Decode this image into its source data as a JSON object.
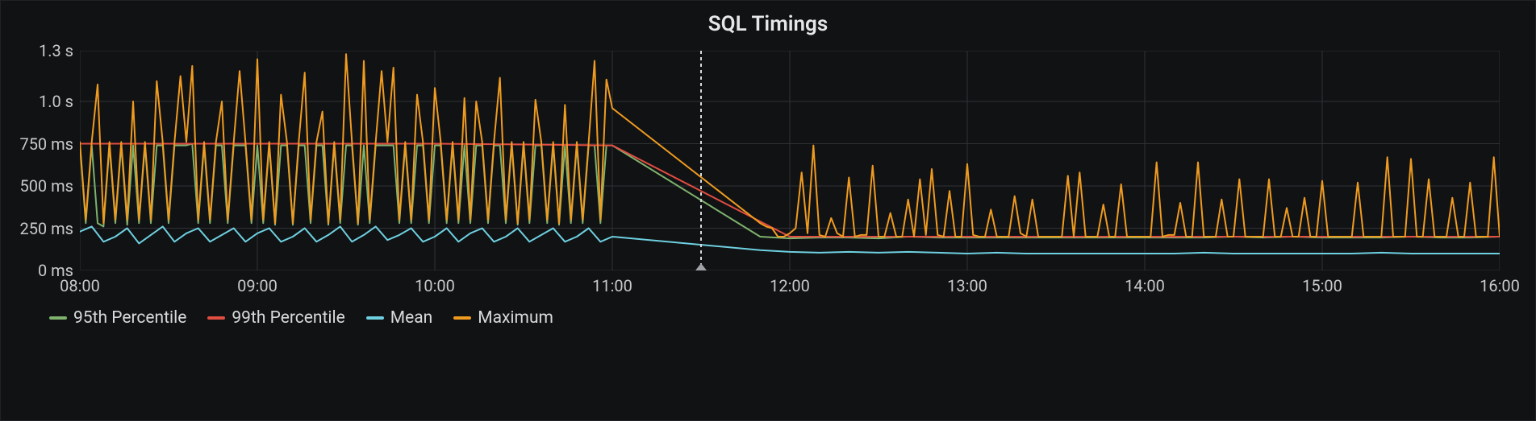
{
  "title": "SQL Timings",
  "legend": [
    {
      "key": "p95",
      "label": "95th Percentile",
      "color": "#7eb26d"
    },
    {
      "key": "p99",
      "label": "99th Percentile",
      "color": "#e24d42"
    },
    {
      "key": "mean",
      "label": "Mean",
      "color": "#6ed0e0"
    },
    {
      "key": "max",
      "label": "Maximum",
      "color": "#ef9b20"
    }
  ],
  "axes": {
    "y": {
      "min": 0,
      "max": 1300,
      "ticks": [
        {
          "v": 0,
          "label": "0 ms"
        },
        {
          "v": 250,
          "label": "250 ms"
        },
        {
          "v": 500,
          "label": "500 ms"
        },
        {
          "v": 750,
          "label": "750 ms"
        },
        {
          "v": 1000,
          "label": "1.0 s"
        },
        {
          "v": 1300,
          "label": "1.3 s"
        }
      ]
    },
    "x": {
      "min": 0,
      "max": 480,
      "ticks": [
        {
          "v": 0,
          "label": "08:00"
        },
        {
          "v": 60,
          "label": "09:00"
        },
        {
          "v": 120,
          "label": "10:00"
        },
        {
          "v": 180,
          "label": "11:00"
        },
        {
          "v": 240,
          "label": "12:00"
        },
        {
          "v": 300,
          "label": "13:00"
        },
        {
          "v": 360,
          "label": "14:00"
        },
        {
          "v": 420,
          "label": "15:00"
        },
        {
          "v": 480,
          "label": "16:00"
        }
      ]
    }
  },
  "cursor_x": 210,
  "chart_data": {
    "type": "line",
    "xlabel": "",
    "ylabel": "",
    "xlim": [
      "08:00",
      "16:00"
    ],
    "ylim": [
      0,
      1300
    ],
    "x_minutes_from_0800": true,
    "cursor_at": "11:30",
    "series": [
      {
        "name": "Maximum",
        "color": "#ef9b20",
        "x": [
          0,
          2,
          4,
          6,
          8,
          10,
          12,
          14,
          16,
          18,
          20,
          22,
          24,
          26,
          28,
          30,
          32,
          34,
          36,
          38,
          40,
          42,
          44,
          46,
          48,
          50,
          52,
          54,
          56,
          58,
          60,
          62,
          64,
          66,
          68,
          70,
          72,
          74,
          76,
          78,
          80,
          82,
          84,
          86,
          88,
          90,
          92,
          94,
          96,
          98,
          100,
          102,
          104,
          106,
          108,
          110,
          112,
          114,
          116,
          118,
          120,
          122,
          124,
          126,
          128,
          130,
          132,
          134,
          136,
          138,
          140,
          142,
          144,
          146,
          148,
          150,
          152,
          154,
          156,
          158,
          160,
          162,
          164,
          166,
          168,
          170,
          172,
          174,
          176,
          178,
          180,
          230,
          232,
          234,
          236,
          238,
          240,
          242,
          244,
          246,
          248,
          250,
          252,
          254,
          256,
          258,
          260,
          262,
          264,
          266,
          268,
          270,
          272,
          274,
          276,
          278,
          280,
          282,
          284,
          286,
          288,
          290,
          292,
          294,
          296,
          298,
          300,
          302,
          304,
          306,
          308,
          310,
          312,
          314,
          316,
          318,
          320,
          322,
          324,
          326,
          328,
          330,
          332,
          334,
          336,
          338,
          340,
          342,
          344,
          346,
          348,
          350,
          352,
          354,
          356,
          358,
          360,
          362,
          364,
          366,
          368,
          370,
          372,
          374,
          376,
          378,
          380,
          382,
          384,
          386,
          388,
          390,
          392,
          394,
          396,
          398,
          400,
          402,
          404,
          406,
          408,
          410,
          412,
          414,
          416,
          418,
          420,
          422,
          424,
          426,
          428,
          430,
          432,
          434,
          436,
          438,
          440,
          442,
          444,
          446,
          448,
          450,
          452,
          454,
          456,
          458,
          460,
          462,
          464,
          466,
          468,
          470,
          472,
          474,
          476,
          478,
          480
        ],
        "y": [
          760,
          300,
          760,
          1100,
          280,
          760,
          300,
          760,
          300,
          1000,
          300,
          760,
          300,
          1120,
          760,
          300,
          760,
          1150,
          760,
          1210,
          300,
          760,
          300,
          760,
          1000,
          300,
          760,
          1180,
          760,
          300,
          1250,
          300,
          760,
          280,
          1040,
          760,
          280,
          760,
          1170,
          300,
          760,
          940,
          280,
          760,
          300,
          1280,
          760,
          280,
          1240,
          300,
          760,
          1180,
          760,
          1200,
          300,
          760,
          300,
          1040,
          760,
          300,
          1080,
          760,
          300,
          760,
          300,
          1020,
          300,
          1000,
          760,
          300,
          760,
          1140,
          300,
          760,
          280,
          760,
          300,
          1010,
          760,
          300,
          760,
          280,
          980,
          300,
          760,
          300,
          760,
          1240,
          300,
          1130,
          960,
          280,
          260,
          250,
          200,
          200,
          220,
          250,
          580,
          220,
          740,
          210,
          200,
          310,
          220,
          200,
          550,
          200,
          210,
          210,
          620,
          200,
          200,
          340,
          200,
          200,
          420,
          200,
          540,
          210,
          600,
          210,
          200,
          470,
          200,
          200,
          630,
          210,
          200,
          200,
          360,
          200,
          200,
          200,
          440,
          220,
          200,
          420,
          200,
          200,
          200,
          200,
          200,
          560,
          200,
          580,
          200,
          200,
          200,
          390,
          200,
          200,
          510,
          200,
          200,
          200,
          200,
          200,
          640,
          200,
          210,
          210,
          400,
          200,
          200,
          640,
          200,
          200,
          200,
          420,
          200,
          200,
          540,
          200,
          200,
          200,
          200,
          540,
          200,
          200,
          370,
          200,
          200,
          430,
          200,
          200,
          530,
          200,
          200,
          200,
          200,
          200,
          520,
          200,
          200,
          200,
          200,
          670,
          200,
          200,
          200,
          660,
          200,
          200,
          540,
          200,
          200,
          200,
          430,
          200,
          200,
          520,
          200,
          200,
          200,
          670,
          200,
          250
        ]
      },
      {
        "name": "95th Percentile",
        "color": "#7eb26d",
        "x": [
          0,
          2,
          4,
          6,
          8,
          10,
          12,
          14,
          16,
          18,
          20,
          22,
          24,
          26,
          28,
          30,
          32,
          34,
          36,
          38,
          40,
          42,
          44,
          46,
          48,
          50,
          52,
          54,
          56,
          58,
          60,
          62,
          64,
          66,
          68,
          70,
          72,
          74,
          76,
          78,
          80,
          82,
          84,
          86,
          88,
          90,
          92,
          94,
          96,
          98,
          100,
          102,
          104,
          106,
          108,
          110,
          112,
          114,
          116,
          118,
          120,
          122,
          124,
          126,
          128,
          130,
          132,
          134,
          136,
          138,
          140,
          142,
          144,
          146,
          148,
          150,
          152,
          154,
          156,
          158,
          160,
          162,
          164,
          166,
          168,
          170,
          172,
          174,
          176,
          178,
          180,
          230,
          240,
          250,
          260,
          270,
          280,
          290,
          300,
          310,
          320,
          330,
          340,
          350,
          360,
          370,
          380,
          390,
          400,
          410,
          420,
          430,
          440,
          450,
          460,
          470,
          480
        ],
        "y": [
          740,
          280,
          740,
          280,
          260,
          740,
          280,
          740,
          270,
          740,
          280,
          740,
          280,
          740,
          740,
          280,
          740,
          740,
          740,
          750,
          280,
          740,
          280,
          740,
          740,
          280,
          740,
          740,
          740,
          280,
          740,
          280,
          740,
          270,
          740,
          740,
          270,
          740,
          740,
          280,
          740,
          740,
          270,
          740,
          280,
          740,
          740,
          270,
          740,
          280,
          740,
          740,
          740,
          740,
          280,
          740,
          280,
          740,
          740,
          280,
          740,
          740,
          280,
          740,
          280,
          740,
          280,
          740,
          740,
          280,
          740,
          740,
          280,
          740,
          270,
          740,
          280,
          740,
          740,
          280,
          740,
          270,
          740,
          280,
          740,
          280,
          740,
          740,
          280,
          740,
          740,
          200,
          190,
          195,
          195,
          190,
          200,
          195,
          195,
          195,
          195,
          195,
          195,
          195,
          195,
          195,
          195,
          200,
          195,
          200,
          195,
          195,
          195,
          200,
          195,
          195,
          200
        ]
      },
      {
        "name": "99th Percentile",
        "color": "#e24d42",
        "x": [
          0,
          60,
          120,
          180,
          240,
          300,
          360,
          420,
          480
        ],
        "y": [
          750,
          750,
          750,
          740,
          200,
          200,
          200,
          200,
          200
        ]
      },
      {
        "name": "Mean",
        "color": "#6ed0e0",
        "x": [
          0,
          4,
          8,
          12,
          16,
          20,
          24,
          28,
          32,
          36,
          40,
          44,
          48,
          52,
          56,
          60,
          64,
          68,
          72,
          76,
          80,
          84,
          88,
          92,
          96,
          100,
          104,
          108,
          112,
          116,
          120,
          124,
          128,
          132,
          136,
          140,
          144,
          148,
          152,
          156,
          160,
          164,
          168,
          172,
          176,
          180,
          230,
          240,
          250,
          260,
          270,
          280,
          290,
          300,
          310,
          320,
          330,
          340,
          350,
          360,
          370,
          380,
          390,
          400,
          410,
          420,
          430,
          440,
          450,
          460,
          470,
          480
        ],
        "y": [
          230,
          260,
          170,
          200,
          250,
          160,
          210,
          260,
          170,
          220,
          250,
          170,
          210,
          250,
          170,
          220,
          250,
          170,
          200,
          250,
          170,
          210,
          260,
          170,
          210,
          260,
          180,
          210,
          250,
          170,
          200,
          250,
          170,
          220,
          250,
          170,
          200,
          250,
          170,
          210,
          250,
          170,
          200,
          250,
          170,
          200,
          120,
          110,
          105,
          110,
          105,
          110,
          105,
          100,
          105,
          100,
          100,
          100,
          100,
          100,
          100,
          105,
          100,
          100,
          100,
          100,
          100,
          105,
          100,
          100,
          100,
          100
        ]
      }
    ]
  }
}
